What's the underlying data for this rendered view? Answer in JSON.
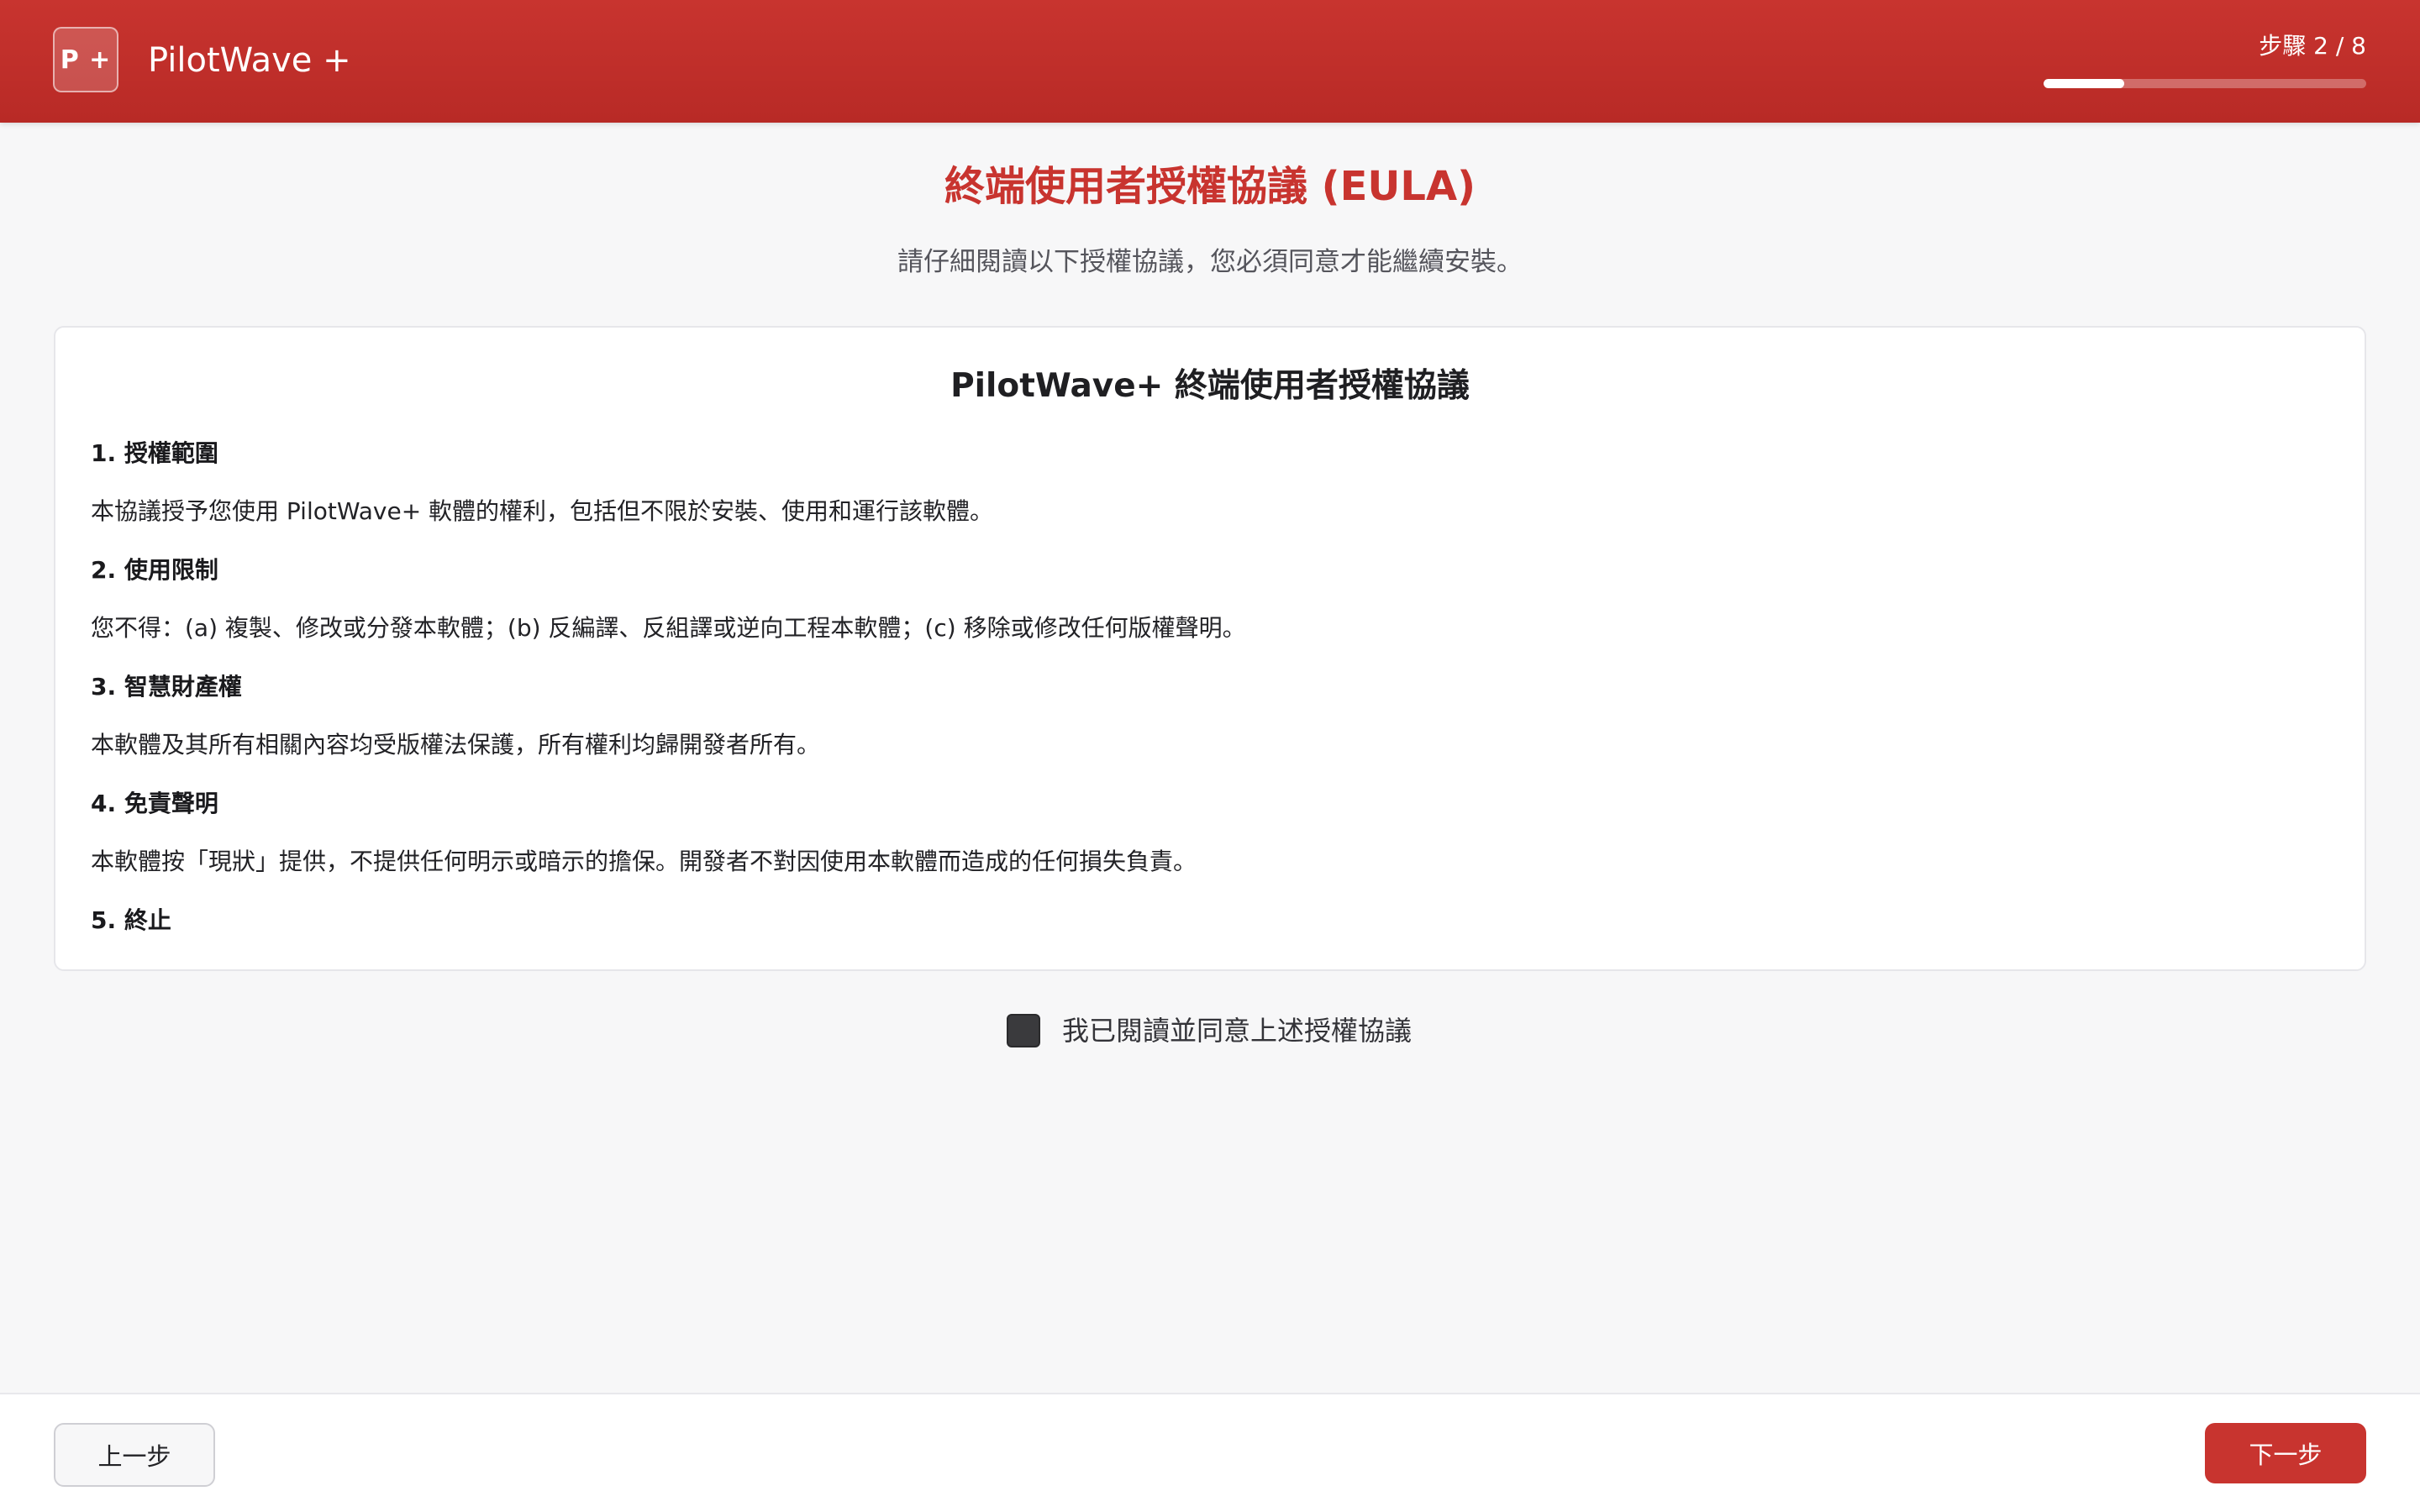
{
  "header": {
    "logo_text": "P +",
    "app_title": "PilotWave +",
    "step_label": "步驟 2 / 8",
    "progress": 0.25
  },
  "page": {
    "title": "終端使用者授權協議 (EULA)",
    "subtitle": "請仔細閱讀以下授權協議，您必須同意才能繼續安裝。"
  },
  "eula": {
    "heading": "PilotWave+ 終端使用者授權協議",
    "sections": [
      {
        "title": "1. 授權範圍",
        "body": "本協議授予您使用 PilotWave+ 軟體的權利，包括但不限於安裝、使用和運行該軟體。"
      },
      {
        "title": "2. 使用限制",
        "body": "您不得：(a) 複製、修改或分發本軟體；(b) 反編譯、反組譯或逆向工程本軟體；(c) 移除或修改任何版權聲明。"
      },
      {
        "title": "3. 智慧財產權",
        "body": "本軟體及其所有相關內容均受版權法保護，所有權利均歸開發者所有。"
      },
      {
        "title": "4. 免責聲明",
        "body": "本軟體按「現狀」提供，不提供任何明示或暗示的擔保。開發者不對因使用本軟體而造成的任何損失負責。"
      },
      {
        "title": "5. 終止",
        "body": ""
      }
    ]
  },
  "agreement": {
    "label": "我已閱讀並同意上述授權協議",
    "checked": false
  },
  "footer": {
    "back_label": "上一步",
    "next_label": "下一步"
  },
  "colors": {
    "brand": "#c8342f",
    "page_background": "#f7f7f8",
    "checkbox": "#3a3a3d"
  }
}
